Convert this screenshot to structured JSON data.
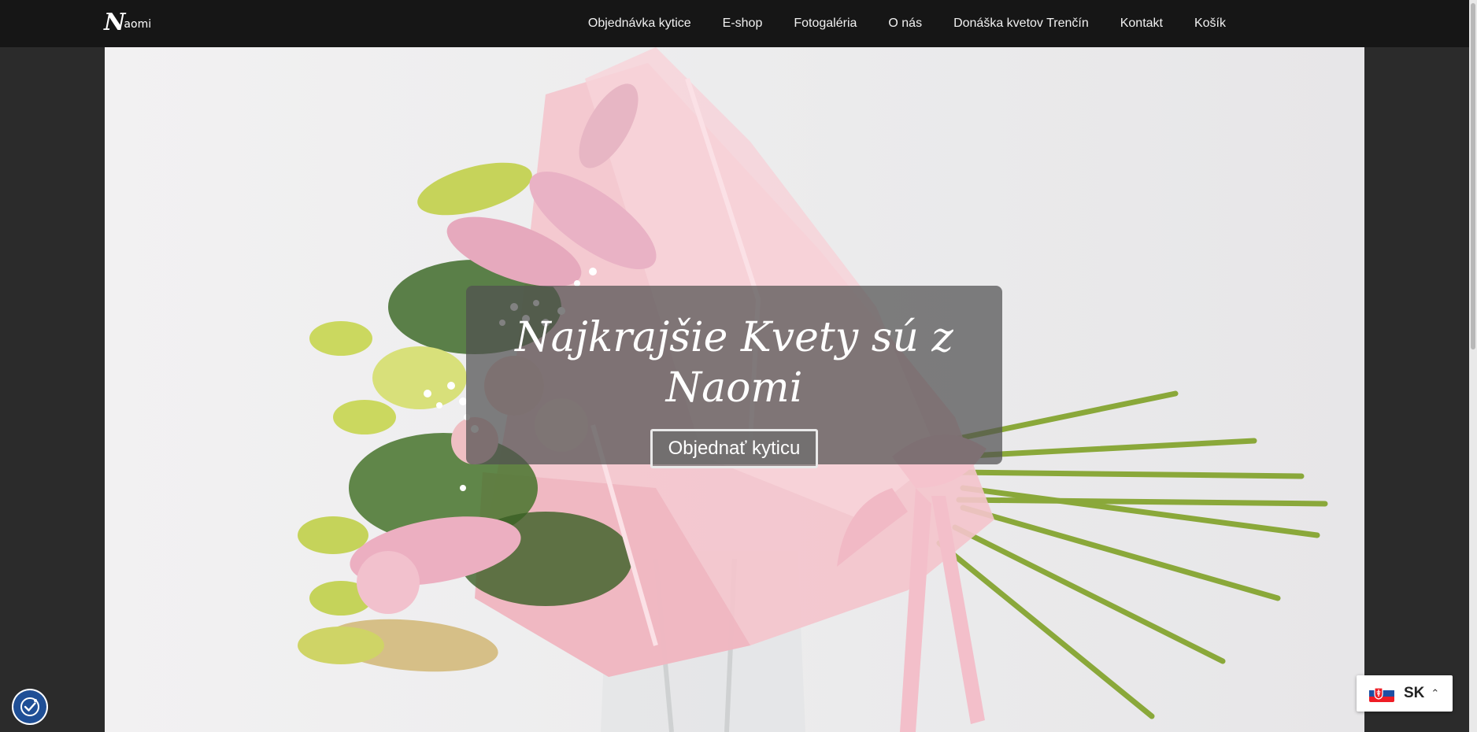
{
  "brand": {
    "logo_initial": "N",
    "logo_rest": "aomi"
  },
  "nav": {
    "items": [
      {
        "label": "Objednávka kytice"
      },
      {
        "label": "E-shop"
      },
      {
        "label": "Fotogaléria"
      },
      {
        "label": "O nás"
      },
      {
        "label": "Donáška kvetov Trenčín"
      },
      {
        "label": "Kontakt"
      },
      {
        "label": "Košík"
      }
    ]
  },
  "hero": {
    "title": "Najkrajšie Kvety sú z Naomi",
    "cta_label": "Objednať kyticu"
  },
  "language": {
    "code": "SK",
    "flag_colors": [
      "#ffffff",
      "#1e4fa3",
      "#ee1c25"
    ]
  },
  "widgets": {
    "accessibility_icon": "accessibility-icon"
  },
  "colors": {
    "topbar": "#161616",
    "overlay": "rgba(80,80,80,0.72)",
    "accessibility_button": "#1f4f96"
  }
}
